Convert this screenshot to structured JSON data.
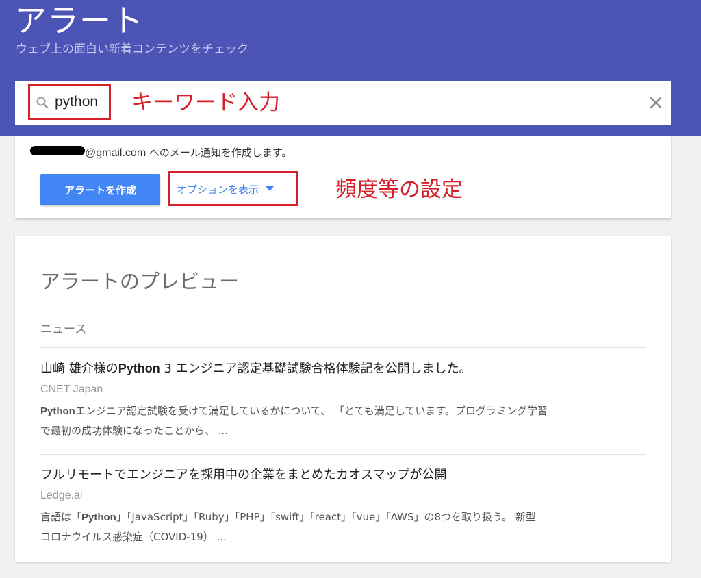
{
  "header": {
    "title": "アラート",
    "subtitle": "ウェブ上の面白い新着コンテンツをチェック"
  },
  "search": {
    "value": "python",
    "annotation": "キーワード入力",
    "clear_icon": "close-icon",
    "icon": "search-icon"
  },
  "settings": {
    "email_domain": "@gmail.com",
    "email_text": " へのメール通知を作成します。",
    "create_button": "アラートを作成",
    "options_button": "オプションを表示",
    "annotation": "頻度等の設定"
  },
  "preview": {
    "title": "アラートのプレビュー",
    "section": "ニュース",
    "articles": [
      {
        "title_pre": "山崎 雄介様の",
        "title_bold": "Python",
        "title_post": " 3 エンジニア認定基礎試験合格体験記を公開しました。",
        "source": "CNET Japan",
        "snippet_bold": "Python",
        "snippet_line1": "エンジニア認定試験を受けて満足しているかについて、 「とても満足しています。プログラミング学習",
        "snippet_line2": "で最初の成功体験になったことから、 ..."
      },
      {
        "title": "フルリモートでエンジニアを採用中の企業をまとめたカオスマップが公開",
        "source": "Ledge.ai",
        "snippet_pre": "言語は「",
        "snippet_bold": "Python",
        "snippet_line1": "」「JavaScript」「Ruby」「PHP」「swift」「react」「vue」「AWS」の8つを取り扱う。 新型",
        "snippet_line2": "コロナウイルス感染症（COVID-19） ..."
      }
    ]
  },
  "colors": {
    "header_bg": "#4c55b6",
    "accent_blue": "#4285f4",
    "annotation_red": "#d6202a"
  }
}
